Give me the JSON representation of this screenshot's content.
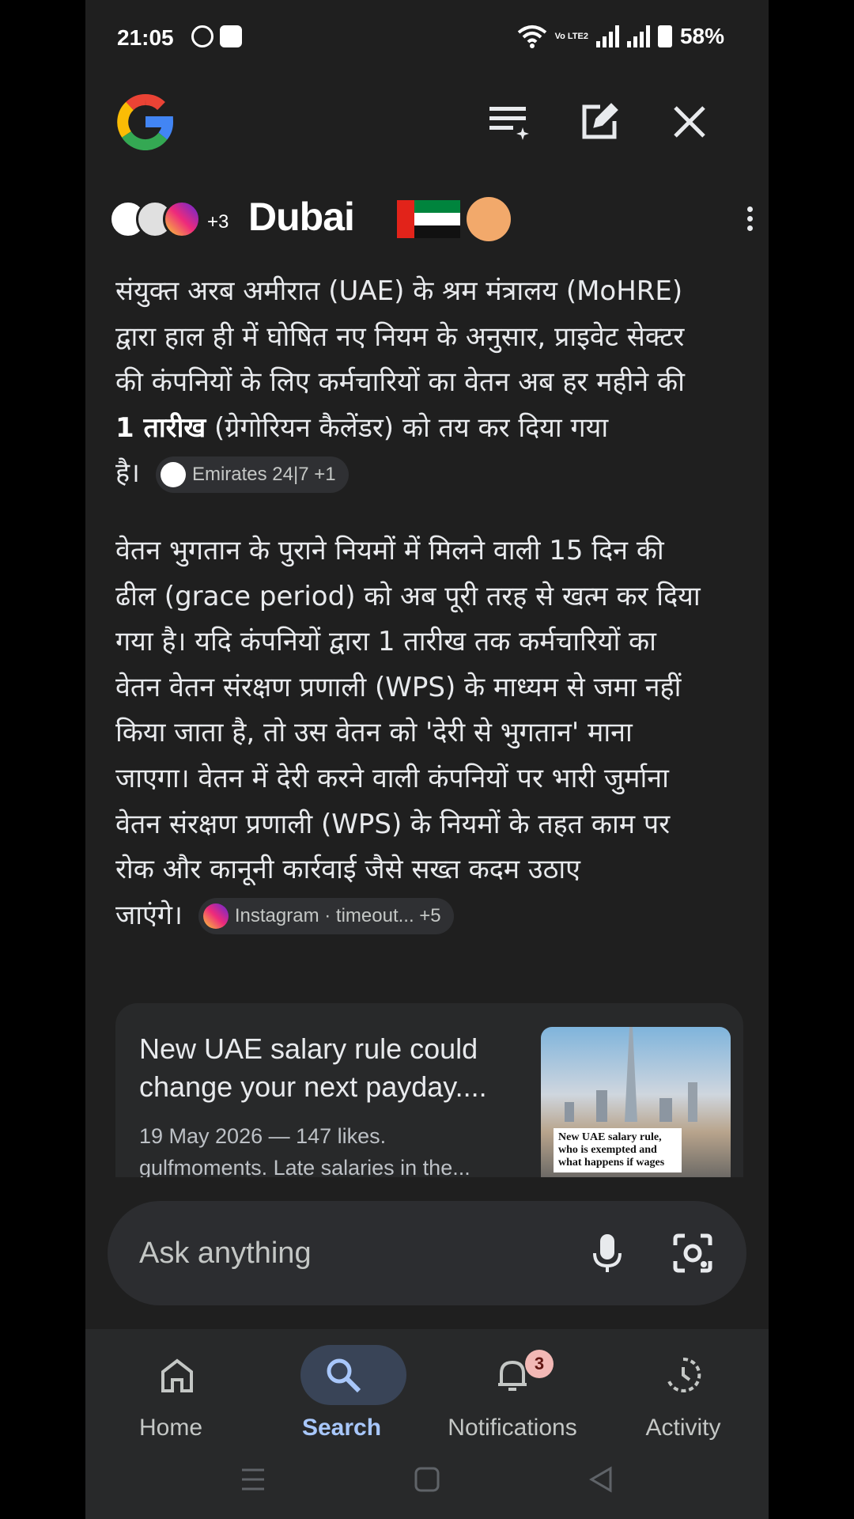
{
  "status_bar": {
    "time": "21:05",
    "battery": "58%",
    "network": "Vo LTE2"
  },
  "header": {
    "logo": "google-g-logo",
    "icons": [
      "playlist-sparkle-icon",
      "edit-icon",
      "close-icon"
    ]
  },
  "source": {
    "extra": "+3",
    "title": "Dubai"
  },
  "paragraph1": {
    "line1": "संयुक्त अरब अमीरात (UAE) के श्रम मंत्रालय (MoHRE)",
    "line2": "द्वारा हाल ही में घोषित नए नियम के अनुसार, प्राइवेट सेक्टर",
    "line3": "की कंपनियों के लिए कर्मचारियों का वेतन अब हर महीने की",
    "line4_bold": "1 तारीख",
    "line4_rest": " (ग्रेगोरियन कैलेंडर) को तय कर दिया गया",
    "line5": "है।",
    "chip": "Emirates 24|7 +1"
  },
  "paragraph2": {
    "line1": "वेतन भुगतान के पुराने नियमों में मिलने वाली 15 दिन की",
    "line2": "ढील (grace period) को अब पूरी तरह से खत्म कर दिया",
    "line3": "गया है। यदि कंपनियों द्वारा 1 तारीख तक कर्मचारियों का",
    "line4": "वेतन वेतन संरक्षण प्रणाली (WPS) के माध्यम से जमा नहीं",
    "line5": "किया जाता है, तो उस वेतन को 'देरी से भुगतान' माना",
    "line6": "जाएगा। वेतन में देरी करने वाली कंपनियों पर भारी जुर्माना",
    "line7": "वेतन संरक्षण प्रणाली (WPS) के नियमों के तहत काम पर",
    "line8": "रोक और कानूनी कार्रवाई जैसे सख्त कदम उठाए",
    "line9": "जाएंगे।",
    "chip": "Instagram · timeout...  +5"
  },
  "card": {
    "title": "New UAE salary rule could change your next payday....",
    "meta1": "19 May 2026 — 147 likes.",
    "meta2": "gulfmoments. Late salaries in the...",
    "thumb_caption": "New UAE salary rule, who is exempted and what happens if wages"
  },
  "ask": {
    "placeholder": "Ask anything"
  },
  "nav": {
    "items": [
      {
        "label": "Home",
        "icon": "home-icon"
      },
      {
        "label": "Search",
        "icon": "search-icon",
        "active": true
      },
      {
        "label": "Notifications",
        "icon": "bell-icon",
        "badge": "3"
      },
      {
        "label": "Activity",
        "icon": "activity-icon"
      }
    ]
  }
}
